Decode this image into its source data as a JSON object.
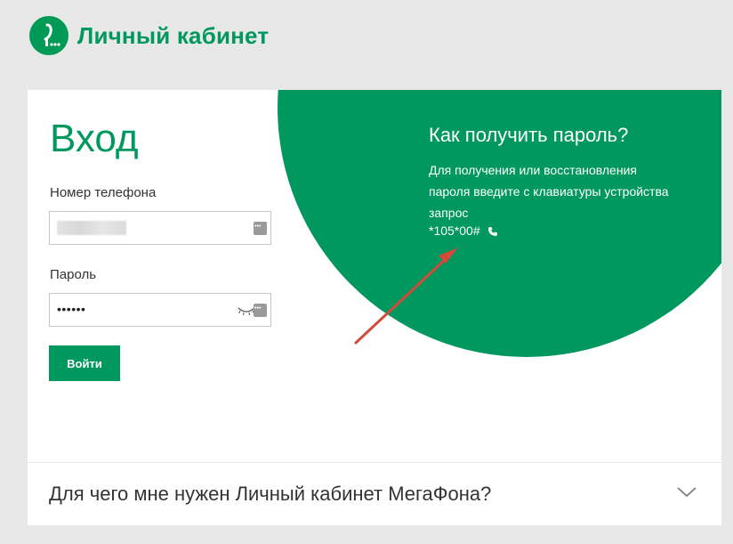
{
  "header": {
    "brand": "Личный кабинет",
    "logo_icon": "megafon-logo-icon"
  },
  "login": {
    "title": "Вход",
    "phone_label": "Номер телефона",
    "phone_value": "",
    "password_label": "Пароль",
    "password_value": "••••••",
    "submit_label": "Войти"
  },
  "help": {
    "title": "Как получить пароль?",
    "text": "Для получения или восстановления пароля введите с клавиатуры устройства запрос",
    "code": "*105*00#"
  },
  "faq": {
    "question": "Для чего мне нужен Личный кабинет МегаФона?"
  },
  "colors": {
    "brand_green": "#00985f",
    "background": "#e8e8e8",
    "arrow": "#d24a3a"
  }
}
